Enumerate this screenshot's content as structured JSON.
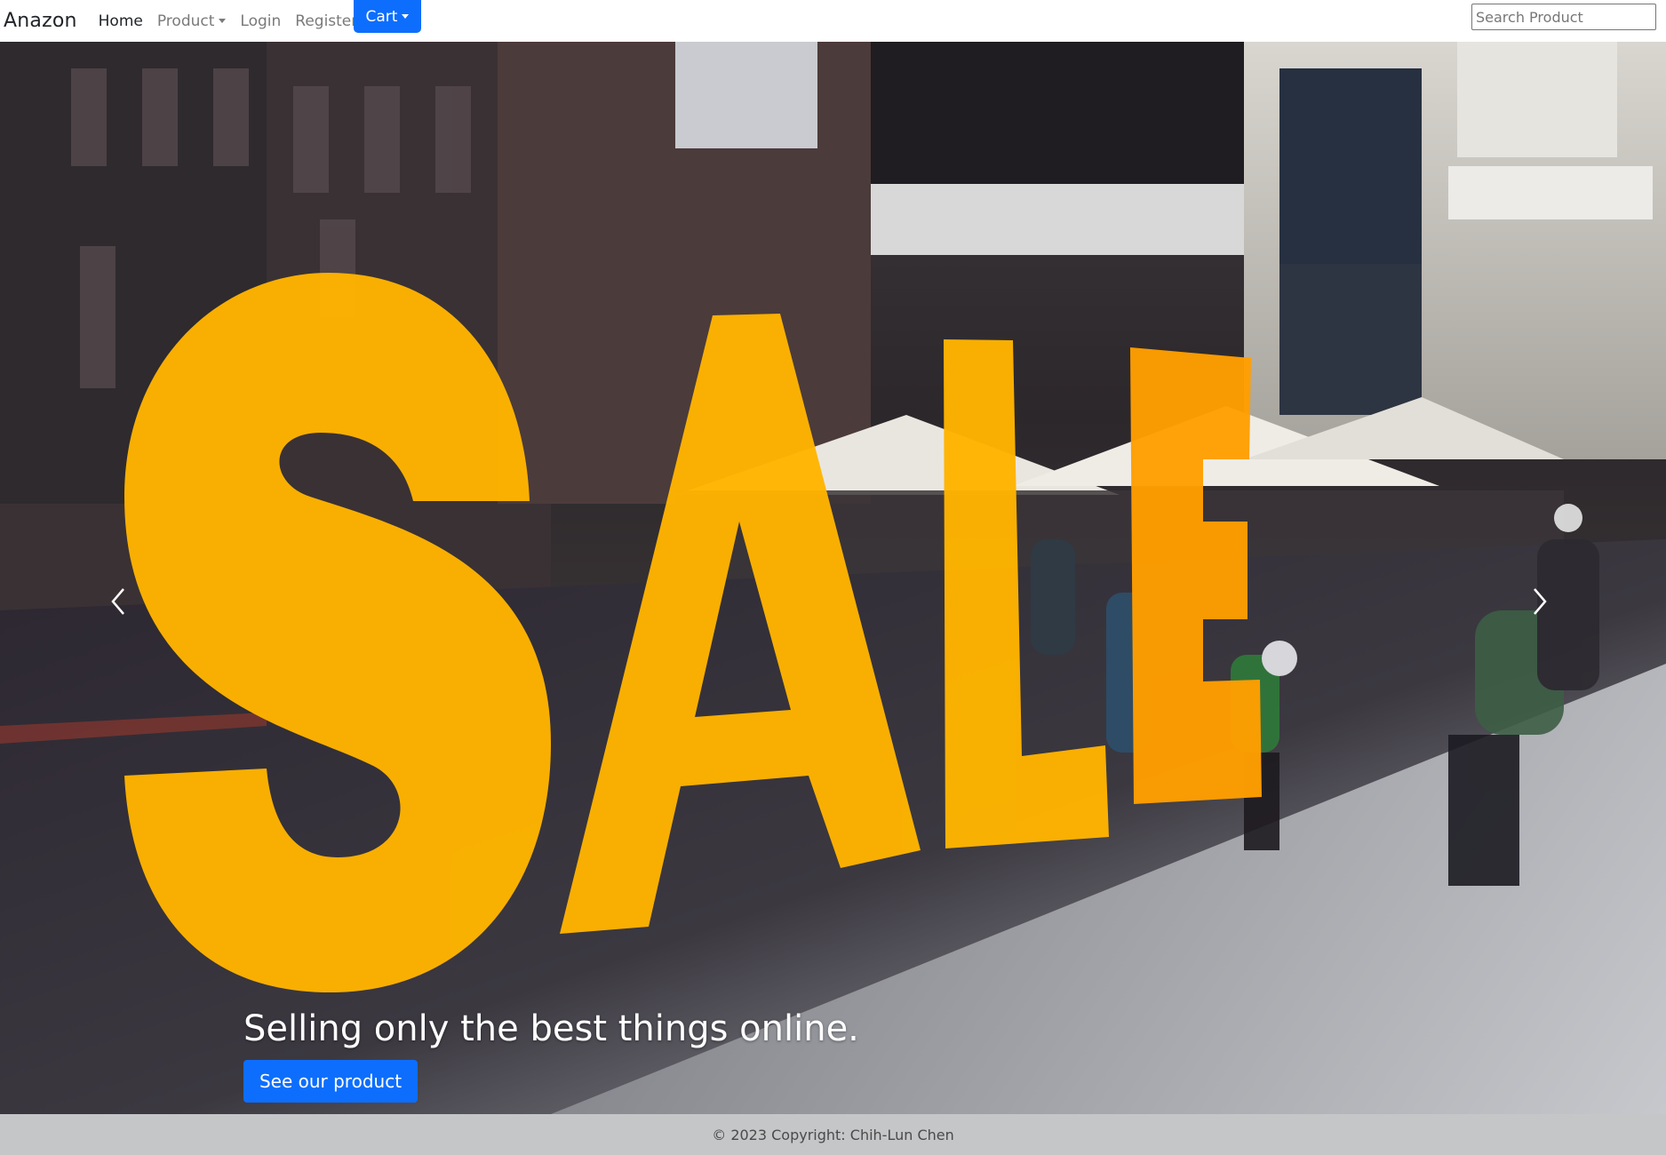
{
  "navbar": {
    "brand": "Anazon",
    "links": [
      {
        "label": "Home"
      },
      {
        "label": "Product"
      },
      {
        "label": "Login"
      },
      {
        "label": "Register"
      }
    ],
    "cart_label": "Cart",
    "search_placeholder": "Search Product"
  },
  "hero": {
    "sign_text": "SALE",
    "caption": "Selling only the best things online.",
    "cta_label": "See our product",
    "prev_icon": "chevron-left-icon",
    "next_icon": "chevron-right-icon"
  },
  "footer": {
    "copyright": "© 2023 Copyright: Chih-Lun Chen"
  },
  "colors": {
    "primary": "#0d6efd",
    "sale_yellow": "#ffb400",
    "footer_bg": "#c5c6c8"
  }
}
